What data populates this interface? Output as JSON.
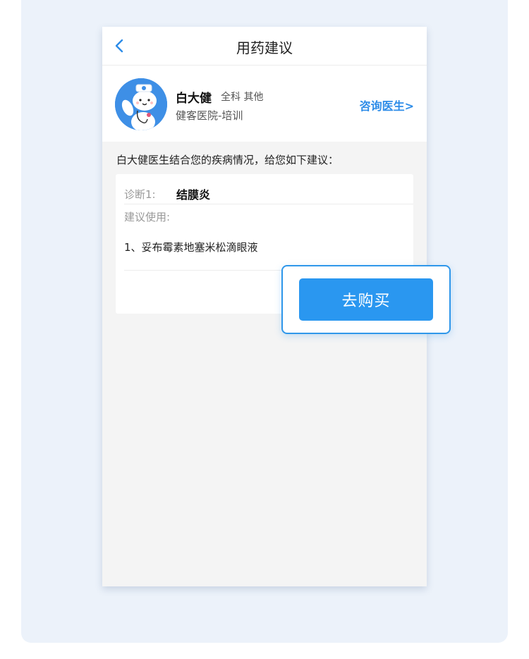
{
  "header": {
    "title": "用药建议"
  },
  "doctor": {
    "name": "白大健",
    "department": "全科 其他",
    "hospital": "健客医院-培训",
    "consult_label": "咨询医生>"
  },
  "advice": {
    "intro": "白大健医生结合您的疾病情况，给您如下建议：",
    "diagnosis_label": "诊断1:",
    "diagnosis_value": "结膜炎",
    "usage_label": "建议使用:",
    "medications": [
      "1、妥布霉素地塞米松滴眼液"
    ]
  },
  "buy_button": {
    "label": "去购买"
  },
  "colors": {
    "accent": "#2a97f0",
    "link": "#2d8ce8",
    "backdrop": "#ecf2fa",
    "page_bg": "#f4f4f4"
  },
  "icons": {
    "back": "chevron-left-icon",
    "avatar": "doctor-bear-avatar"
  }
}
